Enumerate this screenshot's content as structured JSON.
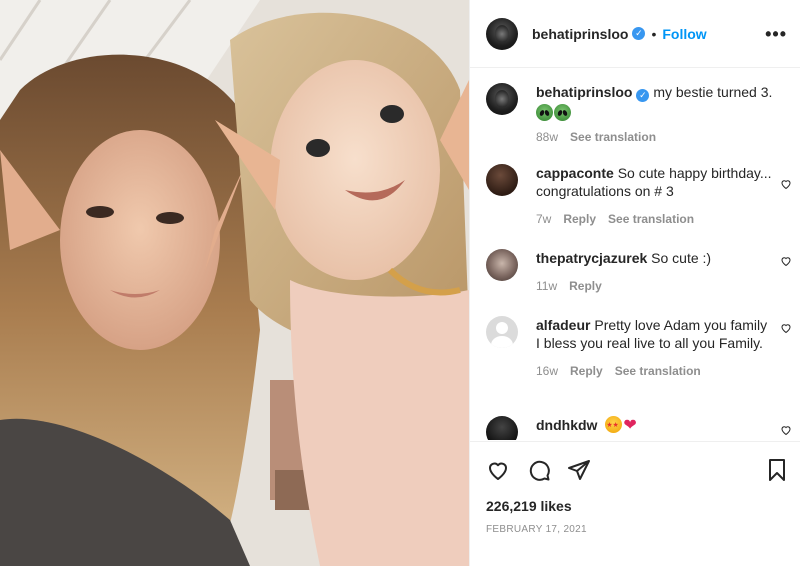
{
  "post": {
    "author": "behatiprinsloo",
    "follow_label": "Follow",
    "separator": "•",
    "more_label": "•••",
    "caption_text": "my bestie turned 3.",
    "caption_time": "88w",
    "see_translation": "See translation"
  },
  "comments": [
    {
      "user": "cappaconte",
      "text": "So cute happy birthday... congratulations on # 3",
      "time": "7w",
      "reply": "Reply",
      "translate": "See translation"
    },
    {
      "user": "thepatrycjazurek",
      "text": "So cute :)",
      "time": "11w",
      "reply": "Reply"
    },
    {
      "user": "alfadeur",
      "text": "Pretty love Adam you family I bless you real live to all you Family.",
      "time": "16w",
      "reply": "Reply",
      "translate": "See translation"
    },
    {
      "user": "dndhkdw",
      "text": ""
    }
  ],
  "actions": {
    "likes": "226,219 likes",
    "date": "FEBRUARY 17, 2021"
  },
  "colors": {
    "link_blue": "#0095f6",
    "verified_blue": "#3897f0",
    "muted": "#8e8e8e",
    "text": "#262626",
    "heart_red": "#e0245e"
  },
  "icons": [
    "verified-badge",
    "more-options-icon",
    "heart-icon",
    "comment-icon",
    "share-icon",
    "bookmark-icon",
    "alien-emoji",
    "star-struck-emoji",
    "red-heart-emoji"
  ]
}
